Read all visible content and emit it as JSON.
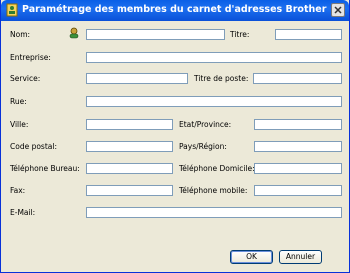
{
  "window": {
    "title": "Paramétrage des membres du carnet d'adresses Brother"
  },
  "fields": {
    "nom": {
      "label": "Nom:",
      "value": ""
    },
    "titre": {
      "label": "Titre:",
      "value": ""
    },
    "entreprise": {
      "label": "Entreprise:",
      "value": ""
    },
    "service": {
      "label": "Service:",
      "value": ""
    },
    "titre_poste": {
      "label": "Titre de poste:",
      "value": ""
    },
    "rue": {
      "label": "Rue:",
      "value": ""
    },
    "ville": {
      "label": "Ville:",
      "value": ""
    },
    "etat": {
      "label": "Etat/Province:",
      "value": ""
    },
    "code_postal": {
      "label": "Code postal:",
      "value": ""
    },
    "pays": {
      "label": "Pays/Région:",
      "value": ""
    },
    "tel_bureau": {
      "label": "Téléphone Bureau:",
      "value": ""
    },
    "tel_domicile": {
      "label": "Téléphone Domicile:",
      "value": ""
    },
    "fax": {
      "label": "Fax:",
      "value": ""
    },
    "tel_mobile": {
      "label": "Téléphone mobile:",
      "value": ""
    },
    "email": {
      "label": "E-Mail:",
      "value": ""
    }
  },
  "buttons": {
    "ok": "OK",
    "cancel": "Annuler"
  },
  "icons": {
    "title": "address-book-icon",
    "person": "person-icon",
    "close": "close-icon"
  }
}
